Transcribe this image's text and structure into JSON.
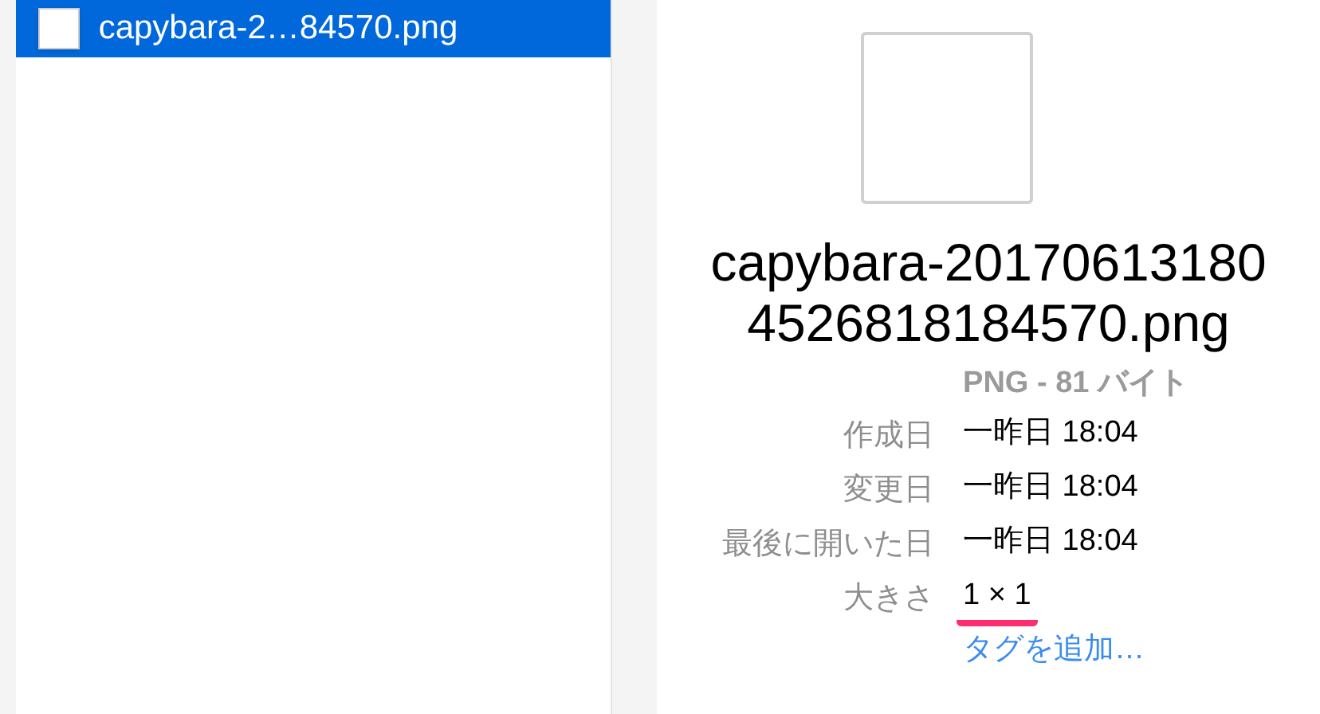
{
  "file_list": [
    {
      "name": "capybara-2…84570.png",
      "selected": true
    }
  ],
  "preview": {
    "title": "capybara-201706131804526818184570.png",
    "subtitle": "PNG - 81 バイト",
    "info": [
      {
        "label": "作成日",
        "value": "一昨日 18:04",
        "marked": false
      },
      {
        "label": "変更日",
        "value": "一昨日 18:04",
        "marked": false
      },
      {
        "label": "最後に開いた日",
        "value": "一昨日 18:04",
        "marked": false
      },
      {
        "label": "大きさ",
        "value": "1 × 1",
        "marked": true
      }
    ],
    "add_tags": "タグを追加…"
  }
}
